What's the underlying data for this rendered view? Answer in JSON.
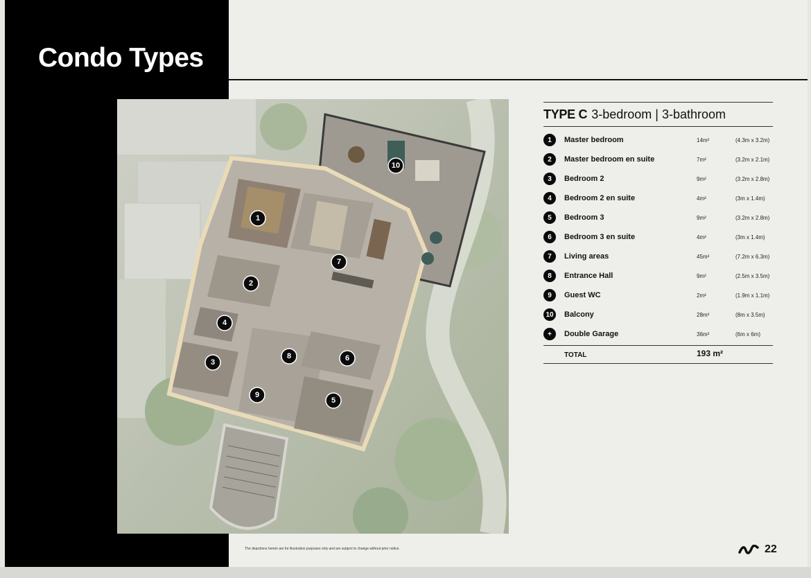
{
  "header": {
    "title": "Condo Types"
  },
  "unit": {
    "type_label": "TYPE C",
    "description": "3-bedroom | 3-bathroom"
  },
  "rooms": [
    {
      "marker": "1",
      "name": "Master bedroom",
      "area": "14m²",
      "dims": "(4.3m x 3.2m)"
    },
    {
      "marker": "2",
      "name": "Master bedroom en suite",
      "area": "7m²",
      "dims": "(3.2m x 2.1m)"
    },
    {
      "marker": "3",
      "name": "Bedroom 2",
      "area": "9m²",
      "dims": "(3.2m x 2.8m)"
    },
    {
      "marker": "4",
      "name": "Bedroom 2 en suite",
      "area": "4m²",
      "dims": "(3m x 1.4m)"
    },
    {
      "marker": "5",
      "name": "Bedroom 3",
      "area": "9m²",
      "dims": "(3.2m x 2.8m)"
    },
    {
      "marker": "6",
      "name": "Bedroom 3 en suite",
      "area": "4m²",
      "dims": "(3m x 1.4m)"
    },
    {
      "marker": "7",
      "name": "Living areas",
      "area": "45m²",
      "dims": "(7.2m x 6.3m)"
    },
    {
      "marker": "8",
      "name": "Entrance Hall",
      "area": "9m²",
      "dims": "(2.5m x 3.5m)"
    },
    {
      "marker": "9",
      "name": "Guest WC",
      "area": "2m²",
      "dims": "(1.9m x 1.1m)"
    },
    {
      "marker": "10",
      "name": "Balcony",
      "area": "28m²",
      "dims": "(8m x 3.5m)"
    },
    {
      "marker": "+",
      "name": "Double Garage",
      "area": "36m²",
      "dims": "(6m x 6m)"
    }
  ],
  "total": {
    "label": "TOTAL",
    "value": "193 m²"
  },
  "floorplan": {
    "markers": [
      "1",
      "2",
      "3",
      "4",
      "5",
      "6",
      "7",
      "8",
      "9",
      "10"
    ]
  },
  "footer": {
    "disclaimer": "The depictions herein are for illustration purposes only and are subject to change without prior notice.",
    "page_number": "22",
    "logo_icon": "brand-wave-icon"
  }
}
